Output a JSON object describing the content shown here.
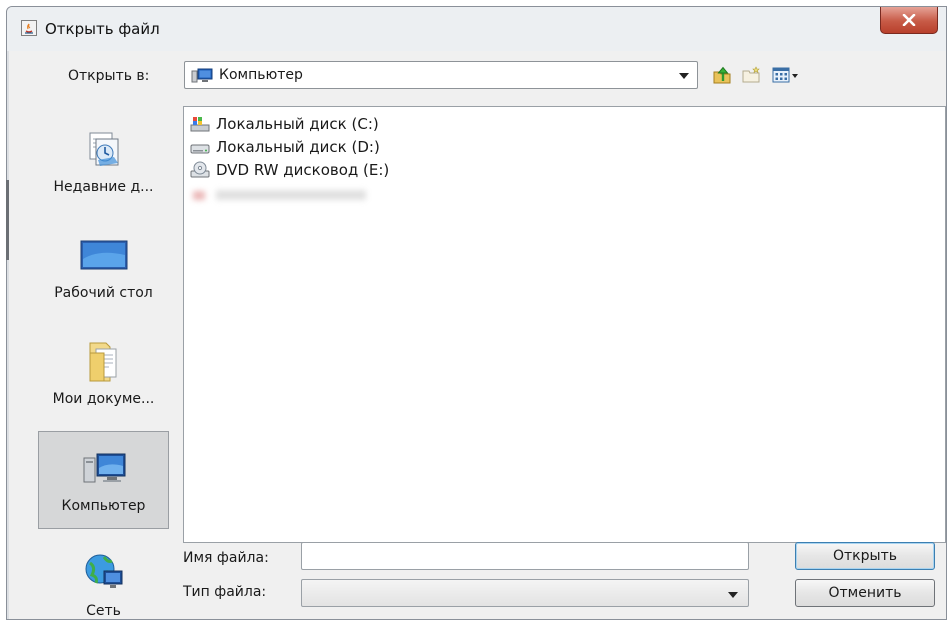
{
  "window": {
    "title": "Открыть файл",
    "close_symbol": "x"
  },
  "toolbar": {
    "look_in_label": "Открыть в:",
    "look_in_value": "Компьютер",
    "up_icon": "up-folder-icon",
    "new_folder_icon": "new-folder-icon",
    "view_icon": "view-menu-icon"
  },
  "places": [
    {
      "label": "Недавние д...",
      "icon": "recent-documents-icon",
      "selected": false
    },
    {
      "label": "Рабочий стол",
      "icon": "desktop-icon",
      "selected": false
    },
    {
      "label": "Мои докуме...",
      "icon": "my-documents-icon",
      "selected": false
    },
    {
      "label": "Компьютер",
      "icon": "computer-icon",
      "selected": true
    },
    {
      "label": "Сеть",
      "icon": "network-icon",
      "selected": false
    }
  ],
  "files": [
    {
      "name": "Локальный диск (C:)",
      "icon": "system-drive-icon"
    },
    {
      "name": "Локальный диск (D:)",
      "icon": "hard-drive-icon"
    },
    {
      "name": "DVD RW дисковод (E:)",
      "icon": "dvd-drive-icon"
    }
  ],
  "form": {
    "filename_label": "Имя файла:",
    "filename_value": "",
    "filetype_label": "Тип файла:",
    "filetype_value": "",
    "open_button": "Открыть",
    "cancel_button": "Отменить"
  },
  "colors": {
    "close_button": "#c75a46",
    "selected_place": "#d6d7d8",
    "default_button_border": "#3c7fb1"
  }
}
